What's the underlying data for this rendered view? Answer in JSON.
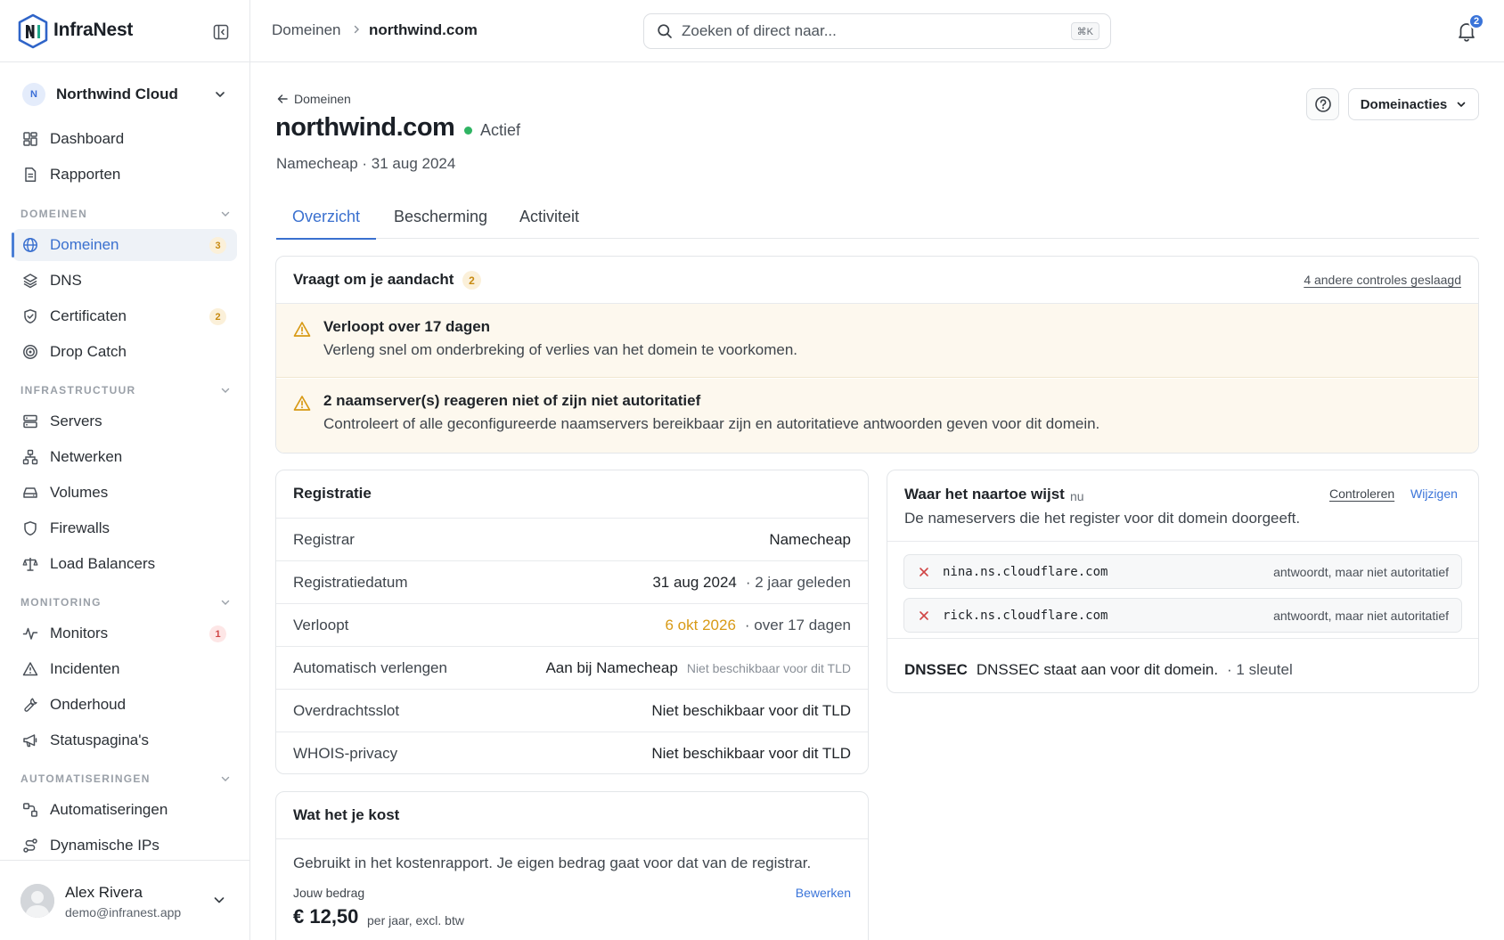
{
  "app": {
    "name": "InfraNest"
  },
  "org": {
    "initial": "N",
    "name": "Northwind Cloud"
  },
  "nav": {
    "top": [
      {
        "label": "Dashboard",
        "icon": "grid-icon"
      },
      {
        "label": "Rapporten",
        "icon": "document-icon"
      }
    ],
    "sections": [
      {
        "title": "DOMEINEN",
        "items": [
          {
            "label": "Domeinen",
            "icon": "globe-icon",
            "badge": "3",
            "active": true
          },
          {
            "label": "DNS",
            "icon": "layers-icon"
          },
          {
            "label": "Certificaten",
            "icon": "shield-check-icon",
            "badge": "2"
          },
          {
            "label": "Drop Catch",
            "icon": "target-icon"
          }
        ]
      },
      {
        "title": "INFRASTRUCTUUR",
        "items": [
          {
            "label": "Servers",
            "icon": "server-icon"
          },
          {
            "label": "Netwerken",
            "icon": "network-icon"
          },
          {
            "label": "Volumes",
            "icon": "drive-icon"
          },
          {
            "label": "Firewalls",
            "icon": "shield-icon"
          },
          {
            "label": "Load Balancers",
            "icon": "scale-icon"
          }
        ]
      },
      {
        "title": "MONITORING",
        "items": [
          {
            "label": "Monitors",
            "icon": "pulse-icon",
            "badge": "1"
          },
          {
            "label": "Incidenten",
            "icon": "alert-triangle-icon"
          },
          {
            "label": "Onderhoud",
            "icon": "wrench-icon"
          },
          {
            "label": "Statuspagina's",
            "icon": "megaphone-icon"
          }
        ]
      },
      {
        "title": "AUTOMATISERINGEN",
        "items": [
          {
            "label": "Automatiseringen",
            "icon": "workflow-icon"
          },
          {
            "label": "Dynamische IPs",
            "icon": "route-icon"
          }
        ]
      }
    ]
  },
  "user": {
    "name": "Alex Rivera",
    "email": "demo@infranest.app"
  },
  "topbar": {
    "breadcrumb_root": "Domeinen",
    "breadcrumb_current": "northwind.com",
    "search_placeholder": "Zoeken of direct naar...",
    "search_shortcut": "⌘K",
    "notifications_count": "2"
  },
  "header": {
    "back_label": "Domeinen",
    "title": "northwind.com",
    "status": "Actief",
    "subtitle": "Namecheap · 31 aug 2024",
    "actions_label": "Domeinacties"
  },
  "tabs": [
    "Overzicht",
    "Bescherming",
    "Activiteit"
  ],
  "attention": {
    "title": "Vraagt om je aandacht",
    "count": "2",
    "passed_link": "4 andere controles geslaagd",
    "items": [
      {
        "title": "Verloopt over 17 dagen",
        "desc": "Verleng snel om onderbreking of verlies van het domein te voorkomen."
      },
      {
        "title": "2 naamserver(s) reageren niet of zijn niet autoritatief",
        "desc": "Controleert of alle geconfigureerde naamservers bereikbaar zijn en autoritatieve antwoorden geven voor dit domein."
      }
    ]
  },
  "registration": {
    "title": "Registratie",
    "rows": {
      "registrar": {
        "key": "Registrar",
        "value": "Namecheap"
      },
      "registered": {
        "key": "Registratiedatum",
        "value": "31 aug 2024",
        "extra": "· 2 jaar geleden"
      },
      "expires": {
        "key": "Verloopt",
        "value": "6 okt 2026",
        "extra": "· over 17 dagen"
      },
      "autorenew": {
        "key": "Automatisch verlengen",
        "value": "Aan bij Namecheap",
        "note": "Niet beschikbaar voor dit TLD"
      },
      "transferlock": {
        "key": "Overdrachtsslot",
        "value": "Niet beschikbaar voor dit TLD"
      },
      "whois": {
        "key": "WHOIS-privacy",
        "value": "Niet beschikbaar voor dit TLD"
      }
    }
  },
  "cost": {
    "title": "Wat het je kost",
    "desc": "Gebruikt in het kostenrapport. Je eigen bedrag gaat voor dat van de registrar.",
    "amount_label": "Jouw bedrag",
    "edit_label": "Bewerken",
    "amount": "€ 12,50",
    "unit": "per jaar, excl. btw"
  },
  "nameservers": {
    "title": "Waar het naartoe wijst",
    "checked": "nu",
    "desc": "De nameservers die het register voor dit domein doorgeeft.",
    "check_label": "Controleren",
    "edit_label": "Wijzigen",
    "items": [
      {
        "host": "nina.ns.cloudflare.com",
        "state": "antwoordt, maar niet autoritatief"
      },
      {
        "host": "rick.ns.cloudflare.com",
        "state": "antwoordt, maar niet autoritatief"
      }
    ],
    "dnssec_label": "DNSSEC",
    "dnssec_text": "DNSSEC staat aan voor dit domein.",
    "dnssec_keys": "· 1 sleutel"
  },
  "colors": {
    "accent": "#3a70cf",
    "warning": "#d89a16",
    "success": "#2fb463",
    "error": "#d04545"
  }
}
